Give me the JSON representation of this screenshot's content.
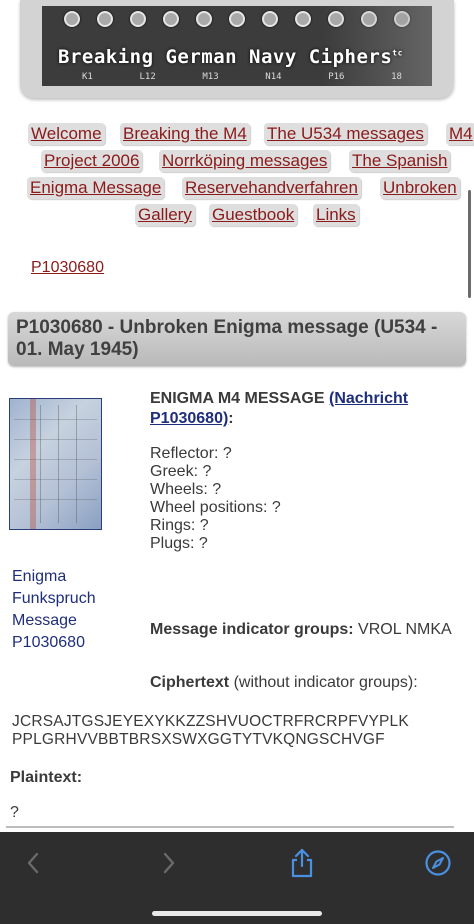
{
  "banner": {
    "title": "Breaking German Navy Ciphers",
    "tm": "tc",
    "rotor_marks": [
      "K1",
      "L12",
      "M13",
      "N14",
      "P16",
      "18"
    ]
  },
  "menu": {
    "items": [
      "Welcome",
      "Breaking the M4",
      "The U534 messages",
      "M4",
      "Project 2006",
      "Norrköping messages",
      "The Spanish",
      "Enigma Message",
      "Reservehandverfahren",
      "Unbroken",
      "Gallery",
      "Guestbook",
      "Links"
    ]
  },
  "breadcrumb": "P1030680",
  "page": {
    "heading": "P1030680 - Unbroken Enigma message (U534 - 01. May 1945)",
    "caption": [
      "Enigma",
      "Funkspruch",
      "Message",
      "P1030680"
    ],
    "lead_prefix": "ENIGMA M4 MESSAGE",
    "lead_link": "(Nachricht P1030680)",
    "lead_suffix": ":",
    "settings": [
      "Reflector: ?",
      "Greek: ?",
      "Wheels: ?",
      "Wheel positions: ?",
      "Rings: ?",
      "Plugs: ?"
    ],
    "indicator_label": "Message indicator groups:",
    "indicator_value": "VROL NMKA",
    "ciphertext_label": "Ciphertext",
    "ciphertext_note": "(without indicator groups):",
    "ciphertext_lines": [
      "JCRSAJTGSJEYEXYKKZZSHVUOCTRFRCRPFVYPLK",
      "PPLGRHVVBBTBRSXSWXGGTYTVKQNGSCHVGF"
    ],
    "plaintext_label": "Plaintext:",
    "plaintext_value": "?"
  },
  "toolbar": {
    "icons": [
      "chevron-left-icon",
      "chevron-right-icon",
      "share-icon",
      "compass-icon"
    ],
    "accent": "#4a90e2",
    "disabled": "#6a6a6a"
  }
}
